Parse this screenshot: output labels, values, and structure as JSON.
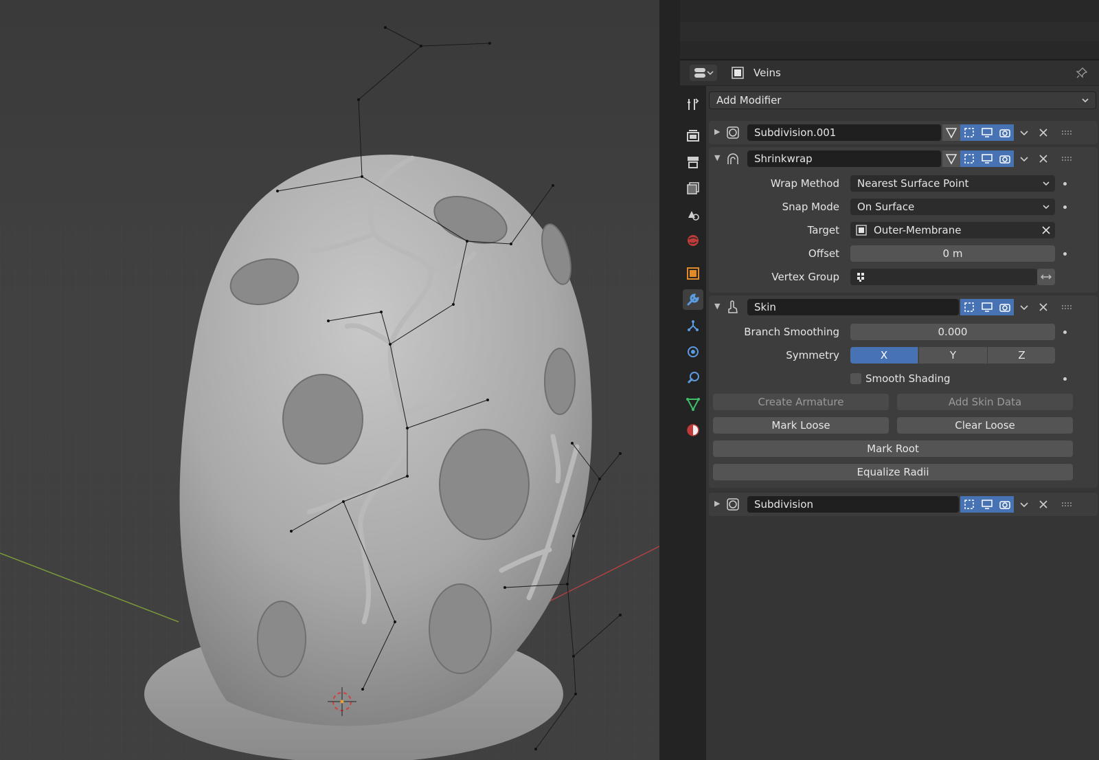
{
  "viewport": {
    "object": "Veins"
  },
  "properties": {
    "object_name": "Veins",
    "add_modifier_label": "Add Modifier",
    "modifiers": [
      {
        "name": "Subdivision.001",
        "expanded": false
      },
      {
        "name": "Shrinkwrap",
        "expanded": true,
        "rows": {
          "wrap_method_label": "Wrap Method",
          "wrap_method_value": "Nearest Surface Point",
          "snap_mode_label": "Snap Mode",
          "snap_mode_value": "On Surface",
          "target_label": "Target",
          "target_value": "Outer-Membrane",
          "offset_label": "Offset",
          "offset_value": "0 m",
          "vertex_group_label": "Vertex Group",
          "vertex_group_value": ""
        }
      },
      {
        "name": "Skin",
        "expanded": true,
        "rows": {
          "branch_smoothing_label": "Branch Smoothing",
          "branch_smoothing_value": "0.000",
          "symmetry_label": "Symmetry",
          "sym_x": "X",
          "sym_y": "Y",
          "sym_z": "Z",
          "smooth_shading_label": "Smooth Shading",
          "create_armature": "Create Armature",
          "add_skin_data": "Add Skin Data",
          "mark_loose": "Mark Loose",
          "clear_loose": "Clear Loose",
          "mark_root": "Mark Root",
          "equalize_radii": "Equalize Radii"
        }
      },
      {
        "name": "Subdivision",
        "expanded": false
      }
    ]
  },
  "colors": {
    "accent": "#4772b3",
    "panel": "#3d3d3d",
    "field": "#545454"
  }
}
